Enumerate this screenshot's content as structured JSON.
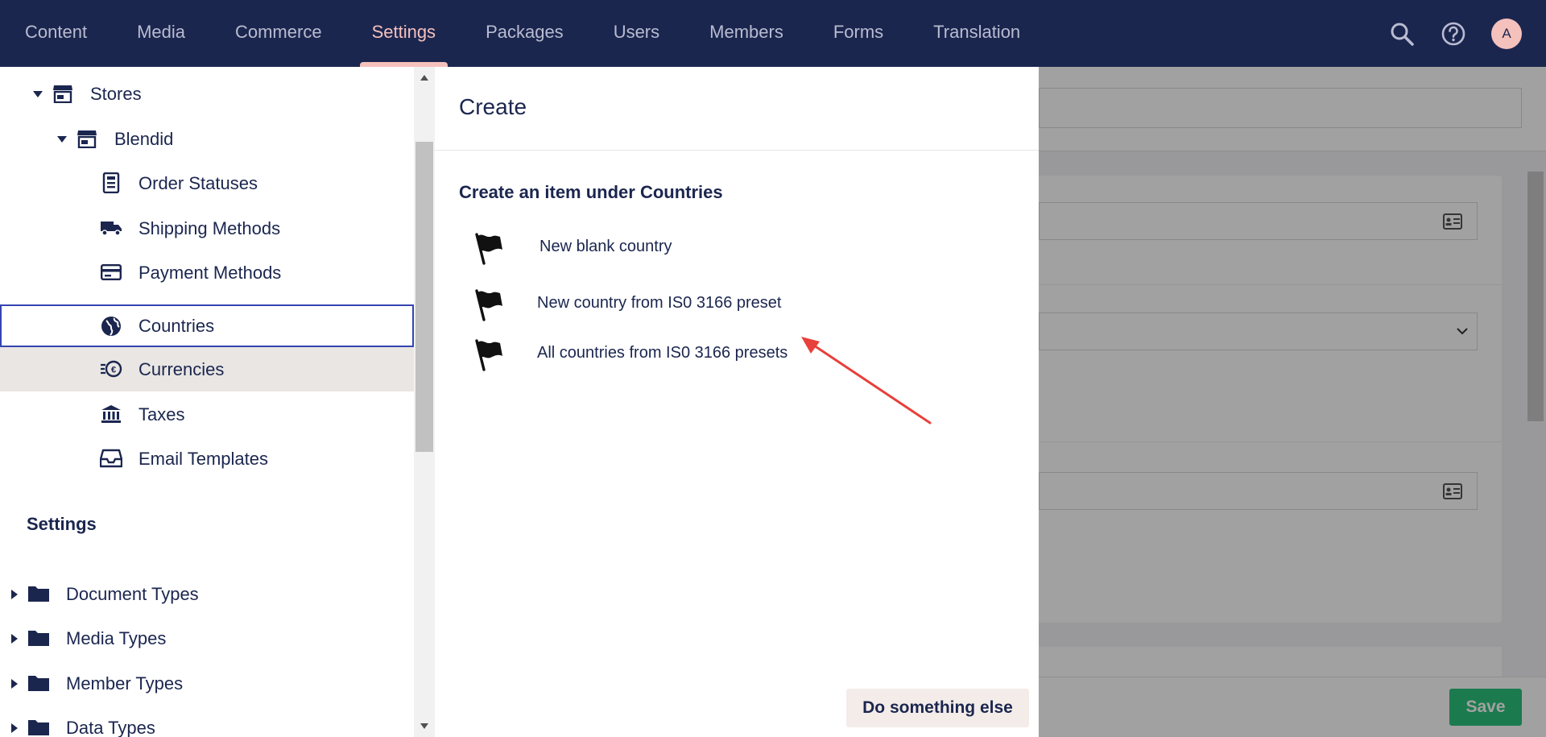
{
  "topnav": {
    "items": [
      "Content",
      "Media",
      "Commerce",
      "Settings",
      "Packages",
      "Users",
      "Members",
      "Forms",
      "Translation"
    ],
    "active": "Settings",
    "avatar_letter": "A",
    "icons": [
      "search-icon",
      "help-icon"
    ]
  },
  "sidebar": {
    "tree": [
      {
        "label": "Stores",
        "icon": "store-icon",
        "expanded": true
      },
      {
        "label": "Blendid",
        "icon": "store-icon",
        "expanded": true
      },
      {
        "label": "Order Statuses",
        "icon": "order-status-icon"
      },
      {
        "label": "Shipping Methods",
        "icon": "truck-icon"
      },
      {
        "label": "Payment Methods",
        "icon": "credit-card-icon"
      },
      {
        "label": "Countries",
        "icon": "globe-icon",
        "selected": true
      },
      {
        "label": "Currencies",
        "icon": "coins-icon"
      },
      {
        "label": "Taxes",
        "icon": "bank-icon"
      },
      {
        "label": "Email Templates",
        "icon": "inbox-icon"
      }
    ],
    "section_title": "Settings",
    "folders": [
      {
        "label": "Document Types"
      },
      {
        "label": "Media Types"
      },
      {
        "label": "Member Types"
      },
      {
        "label": "Data Types"
      }
    ]
  },
  "create_panel": {
    "title": "Create",
    "subtitle": "Create an item under Countries",
    "options": [
      {
        "label": "New blank country",
        "icon": "flag-icon"
      },
      {
        "label": "New country from IS0 3166 preset",
        "icon": "flag-icon"
      },
      {
        "label": "All countries from IS0 3166 presets",
        "icon": "flag-icon"
      }
    ],
    "secondary_button": "Do something else"
  },
  "editor": {
    "save_label": "Save"
  },
  "colors": {
    "nav_bg": "#1b264f",
    "nav_active": "#f5c1bc",
    "selection_border": "#3544b1",
    "save_green": "#2bc37c",
    "annotation_red": "#e8403a"
  }
}
